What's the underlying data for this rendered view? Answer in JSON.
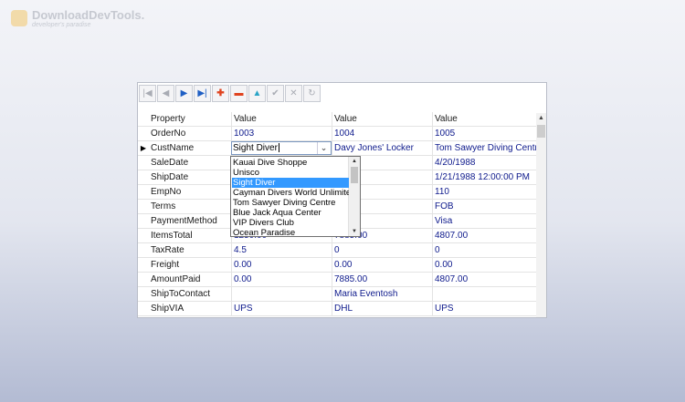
{
  "watermark": {
    "title": "DownloadDevTools.",
    "subtitle": "developer's paradise"
  },
  "navigator": {
    "buttons": [
      {
        "name": "first-record-icon",
        "glyph": "|◀",
        "style": "dis"
      },
      {
        "name": "prior-record-icon",
        "glyph": "◀",
        "style": "dis"
      },
      {
        "name": "next-record-icon",
        "glyph": "▶",
        "style": "blue"
      },
      {
        "name": "last-record-icon",
        "glyph": "▶|",
        "style": "blue"
      },
      {
        "name": "insert-record-icon",
        "glyph": "✚",
        "style": "red"
      },
      {
        "name": "delete-record-icon",
        "glyph": "▬",
        "style": "red"
      },
      {
        "name": "edit-record-icon",
        "glyph": "▲",
        "style": "teal"
      },
      {
        "name": "post-edit-icon",
        "glyph": "✔",
        "style": "dis"
      },
      {
        "name": "cancel-edit-icon",
        "glyph": "✕",
        "style": "dis"
      },
      {
        "name": "refresh-icon",
        "glyph": "↻",
        "style": "dis"
      }
    ]
  },
  "grid": {
    "headers": [
      "Property",
      "Value",
      "Value",
      "Value"
    ],
    "rows": [
      {
        "property": "OrderNo",
        "values": [
          "1003",
          "1004",
          "1005"
        ]
      },
      {
        "property": "CustName",
        "values": [
          "Sight Diver",
          "Davy Jones' Locker",
          "Tom Sawyer Diving Centre"
        ],
        "active": true
      },
      {
        "property": "SaleDate",
        "values": [
          "",
          "988",
          "4/20/1988"
        ]
      },
      {
        "property": "ShipDate",
        "values": [
          "",
          "988",
          "1/21/1988 12:00:00 PM"
        ]
      },
      {
        "property": "EmpNo",
        "values": [
          "",
          "",
          "110"
        ]
      },
      {
        "property": "Terms",
        "values": [
          "",
          "",
          "FOB"
        ]
      },
      {
        "property": "PaymentMethod",
        "values": [
          "",
          "",
          "Visa"
        ]
      },
      {
        "property": "ItemsTotal",
        "values": [
          "1250.00",
          "7885.00",
          "4807.00"
        ]
      },
      {
        "property": "TaxRate",
        "values": [
          "4.5",
          "0",
          "0"
        ]
      },
      {
        "property": "Freight",
        "values": [
          "0.00",
          "0.00",
          "0.00"
        ]
      },
      {
        "property": "AmountPaid",
        "values": [
          "0.00",
          "7885.00",
          "4807.00"
        ]
      },
      {
        "property": "ShipToContact",
        "values": [
          "",
          "Maria Eventosh",
          ""
        ]
      },
      {
        "property": "ShipVIA",
        "values": [
          "UPS",
          "DHL",
          "UPS"
        ]
      }
    ]
  },
  "editor": {
    "value": "Sight Diver",
    "dropdown_icon": "chevron-down-icon"
  },
  "dropdown": {
    "items": [
      "Kauai Dive Shoppe",
      "Unisco",
      "Sight Diver",
      "Cayman Divers World Unlimited",
      "Tom Sawyer Diving Centre",
      "Blue Jack Aqua Center",
      "VIP Divers Club",
      "Ocean Paradise"
    ],
    "selected": "Sight Diver"
  }
}
